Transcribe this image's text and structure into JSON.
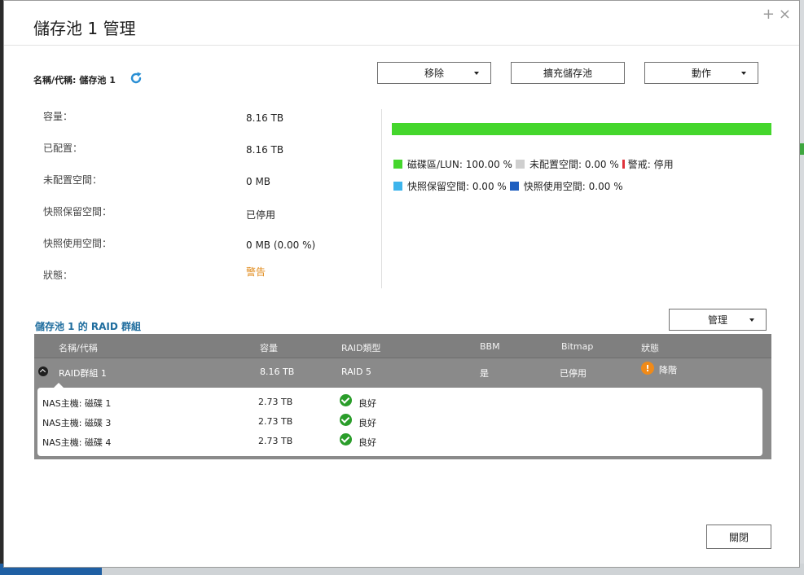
{
  "modal": {
    "title": "儲存池 1 管理",
    "plus": "+",
    "close": "×"
  },
  "pool": {
    "name_label": "名稱/代稱:",
    "name_value": "儲存池 1"
  },
  "toolbar": {
    "remove": "移除",
    "expand": "擴充儲存池",
    "action": "動作"
  },
  "properties": [
    {
      "label": "容量：",
      "value": "8.16 TB"
    },
    {
      "label": "已配置：",
      "value": "8.16 TB"
    },
    {
      "label": "未配置空間：",
      "value": "0 MB"
    },
    {
      "label": "快照保留空間：",
      "value": "已停用"
    },
    {
      "label": "快照使用空間：",
      "value": "0 MB (0.00 %)"
    },
    {
      "label": "狀態：",
      "value": "警告"
    }
  ],
  "usage": {
    "bar_fraction": 1.0,
    "legend": [
      {
        "label": "磁碟區/LUN: 100.00 %",
        "color": "#44d62c"
      },
      {
        "label": "未配置空間:  0.00 %",
        "color": "#cfcfcf"
      },
      {
        "label": "警戒: 停用",
        "color": "#e0323b"
      },
      {
        "label": "快照保留空間:  0.00 %",
        "color": "#3db4ec"
      },
      {
        "label": "快照使用空間:  0.00 %",
        "color": "#1f5fc0"
      }
    ]
  },
  "raid": {
    "section_title": "儲存池 1 的 RAID 群組",
    "manage_label": "管理",
    "columns": [
      "名稱/代稱",
      "容量",
      "RAID類型",
      "BBM",
      "Bitmap",
      "狀態"
    ],
    "group": {
      "name": "RAID群組 1",
      "capacity": "8.16 TB",
      "type": "RAID 5",
      "bbm": "是",
      "bitmap": "已停用",
      "status": "降階"
    },
    "disks": [
      {
        "name": "NAS主機: 磁碟 1",
        "capacity": "2.73 TB",
        "status": "良好"
      },
      {
        "name": "NAS主機: 磁碟 3",
        "capacity": "2.73 TB",
        "status": "良好"
      },
      {
        "name": "NAS主機: 磁碟 4",
        "capacity": "2.73 TB",
        "status": "良好"
      }
    ]
  },
  "footer": {
    "close_label": "關閉"
  }
}
